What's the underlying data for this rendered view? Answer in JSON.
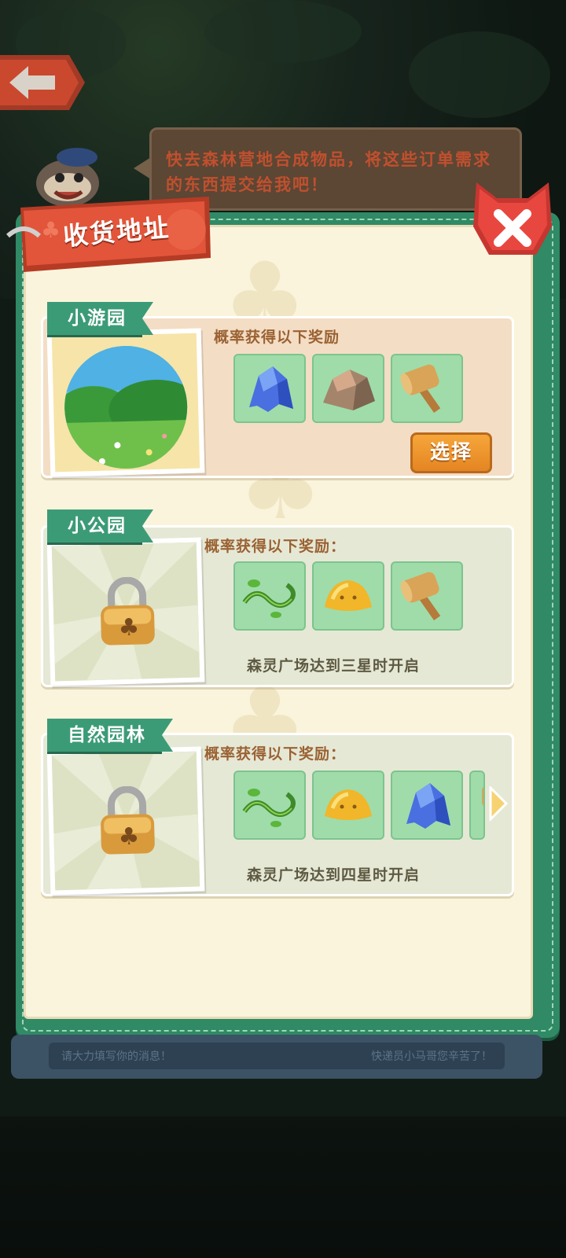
{
  "speech": {
    "text": "快去森林营地合成物品，将这些订单需求的东西提交给我吧！"
  },
  "panel": {
    "title": "收货地址"
  },
  "locations": [
    {
      "name": "小游园",
      "reward_label": "概率获得以下奖励",
      "status": "unlocked",
      "rewards": [
        "blue-crystal-icon",
        "rock-icon",
        "wooden-mallet-icon"
      ],
      "select_label": "选择"
    },
    {
      "name": "小公园",
      "reward_label": "概率获得以下奖励：",
      "status": "locked",
      "rewards": [
        "vine-icon",
        "yellow-slime-icon",
        "wooden-mallet-icon"
      ],
      "unlock_text": "森灵广场达到三星时开启"
    },
    {
      "name": "自然园林",
      "reward_label": "概率获得以下奖励：",
      "status": "locked",
      "rewards": [
        "vine-icon",
        "yellow-slime-icon",
        "blue-crystal-icon",
        "wooden-mallet-icon"
      ],
      "unlock_text": "森灵广场达到四星时开启"
    }
  ],
  "footer": {
    "left_text": "请大力填写你的消息！",
    "right_text": "快递员小马哥您辛苦了！"
  },
  "colors": {
    "panel_green": "#2f8a65",
    "panel_cream": "#fbf4dc",
    "title_red": "#e2553a",
    "select_orange": "#e48523",
    "tile_green": "#9fdcaa"
  }
}
